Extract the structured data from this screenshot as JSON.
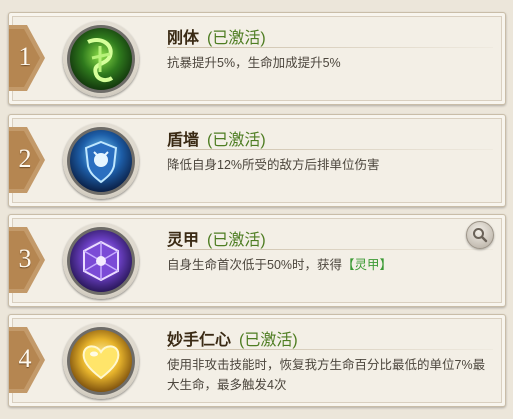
{
  "status_label": "(已激活)",
  "skills": [
    {
      "number": "1",
      "name": "刚体",
      "desc": "抗暴提升5%，生命加成提升5%",
      "icon": "green-wind-rune-icon"
    },
    {
      "number": "2",
      "name": "盾墙",
      "desc": "降低自身12%所受的敌方后排单位伤害",
      "icon": "blue-shield-icon"
    },
    {
      "number": "3",
      "name": "灵甲",
      "desc_before": "自身生命首次低于50%时，获得",
      "desc_highlight": "【灵甲】",
      "icon": "purple-crystal-cube-icon"
    },
    {
      "number": "4",
      "name": "妙手仁心",
      "desc": "使用非攻击技能时，恢复我方生命百分比最低的单位7%最大生命，最多触发4次",
      "icon": "golden-heart-icon"
    }
  ],
  "colors": {
    "status": "#4e7d22",
    "highlight": "#3c9a35",
    "title": "#3a2a14"
  }
}
